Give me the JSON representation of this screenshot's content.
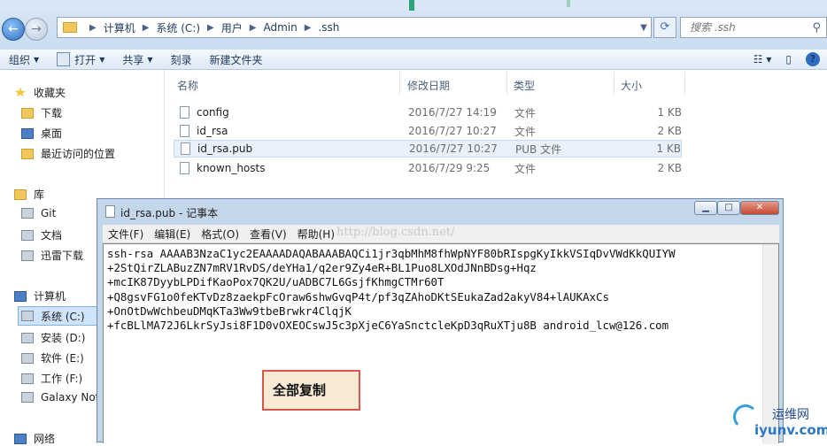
{
  "nav_buttons": {
    "back": "←",
    "forward": "→"
  },
  "address": {
    "crumbs": [
      "计算机",
      "系统 (C:)",
      "用户",
      "Admin",
      ".ssh"
    ],
    "search_placeholder": "搜索 .ssh"
  },
  "toolbar": {
    "organize": "组织",
    "open": "打开",
    "share": "共享",
    "burn": "刻录",
    "new_folder": "新建文件夹"
  },
  "sidebar": {
    "favorites": "收藏夹",
    "downloads": "下载",
    "desktop": "桌面",
    "recent": "最近访问的位置",
    "library": "库",
    "git": "Git",
    "documents": "文档",
    "xunlei": "迅雷下载",
    "computer": "计算机",
    "drive_c": "系统 (C:)",
    "drive_d": "安装 (D:)",
    "drive_e": "软件 (E:)",
    "drive_f": "工作 (F:)",
    "galaxy": "Galaxy Not",
    "network": "网络"
  },
  "columns": {
    "name": "名称",
    "date": "修改日期",
    "type": "类型",
    "size": "大小"
  },
  "files": [
    {
      "name": "config",
      "date": "2016/7/27 14:19",
      "type": "文件",
      "size": "1 KB"
    },
    {
      "name": "id_rsa",
      "date": "2016/7/27 10:27",
      "type": "文件",
      "size": "2 KB"
    },
    {
      "name": "id_rsa.pub",
      "date": "2016/7/27 10:27",
      "type": "PUB 文件",
      "size": "1 KB"
    },
    {
      "name": "known_hosts",
      "date": "2016/7/29 9:25",
      "type": "文件",
      "size": "2 KB"
    }
  ],
  "notepad": {
    "title": "id_rsa.pub - 记事本",
    "menu": [
      "文件(F)",
      "编辑(E)",
      "格式(O)",
      "查看(V)",
      "帮助(H)"
    ],
    "content": "ssh-rsa AAAAB3NzaC1yc2EAAAADAQABAAABAQCi1jr3qbMhM8fhWpNYF80bRIspgKyIkkVSIqDvVWdKkQUIYW\n+2StQirZLABuzZN7mRV1RvDS/deYHa1/q2er9Zy4eR+BL1Puo8LXOdJNnBDsg+Hqz\n+mcIK87DyybLPDifKaoPox7QK2U/uADBC7L6GsjfKhmgCTMr60T\n+Q8gsvFG1o0feKTvDz8zaekpFcOraw6shwGvqP4t/pf3qZAhoDKtSEukaZad2akyV84+lAUKAxCs\n+OnOtDwWchbeuDMqKTa3Ww9tbeBrwkr4ClqjK\n+fcBLlMA72J6LkrSyJsi8F1D0vOXEOCswJ5c3pXjeC6YaSnctcleKpD3qRuXTju8B android_lcw@126.com"
  },
  "watermark": "http://blog.csdn.net/",
  "callout": "全部复制",
  "logo": {
    "line1": "运维网",
    "line2": "iyunv.com"
  }
}
